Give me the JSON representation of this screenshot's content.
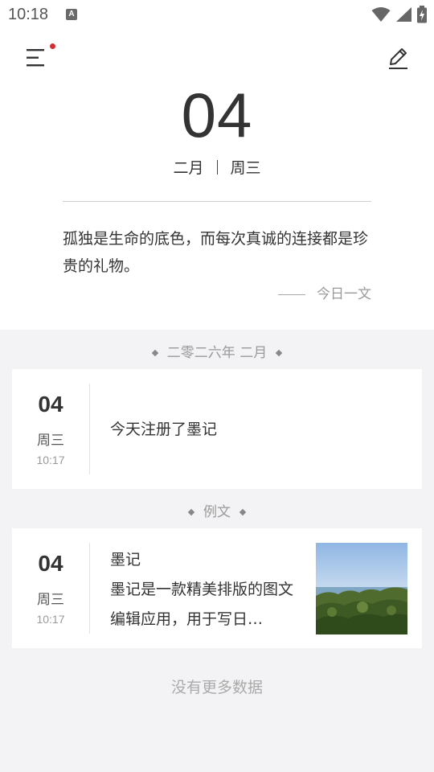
{
  "status_bar": {
    "time": "10:18",
    "notification_icon_letter": "A"
  },
  "header": {
    "day": "04",
    "month": "二月",
    "weekday": "周三"
  },
  "quote": {
    "text": "孤独是生命的底色，而每次真诚的连接都是珍贵的礼物。",
    "source": "今日一文"
  },
  "sections": [
    {
      "title": "二零二六年 二月",
      "entries": [
        {
          "day": "04",
          "weekday": "周三",
          "time": "10:17",
          "text": "今天注册了墨记"
        }
      ]
    },
    {
      "title": "例文",
      "entries": [
        {
          "day": "04",
          "weekday": "周三",
          "time": "10:17",
          "title": "墨记",
          "excerpt": "墨记是一款精美排版的图文编辑应用，用于写日…"
        }
      ]
    }
  ],
  "footer": {
    "no_more": "没有更多数据"
  },
  "colors": {
    "accent_dot": "#d32f2f",
    "background": "#f3f3f5",
    "card": "#ffffff"
  }
}
